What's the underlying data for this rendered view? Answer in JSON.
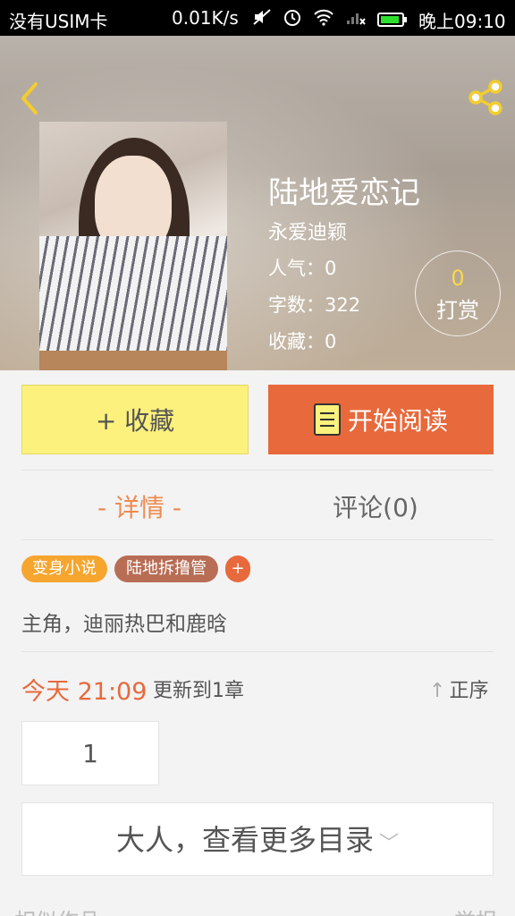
{
  "status_bar": {
    "carrier": "没有USIM卡",
    "speed": "0.01K/s",
    "time": "晚上09:10"
  },
  "book": {
    "title": "陆地爱恋记",
    "author": "永爱迪颖",
    "popularity": "人气：0",
    "word_count": "字数：322",
    "favorites": "收藏：0"
  },
  "tip": {
    "count": "0",
    "label": "打赏"
  },
  "actions": {
    "favorite_label": "+ 收藏",
    "read_label": "开始阅读"
  },
  "tabs": {
    "detail": "- 详情 -",
    "comments": "评论(0)"
  },
  "tags": [
    "变身小说",
    "陆地拆撸管",
    "+"
  ],
  "description": "主角，迪丽热巴和鹿晗",
  "update": {
    "time": "今天 21:09",
    "text": "更新到1章",
    "sort_label": "正序"
  },
  "chapters": [
    "1"
  ],
  "more_catalog": "大人，查看更多目录",
  "bottom": {
    "left": "相似作品",
    "right": "举报"
  },
  "colors": {
    "accent_orange": "#e8693b",
    "favorite_yellow": "#fbf17c",
    "tab_active": "#ee8a4f"
  },
  "icons": [
    "back-icon",
    "share-icon",
    "book-icon",
    "sort-arrow-icon",
    "chevron-down-icon"
  ]
}
